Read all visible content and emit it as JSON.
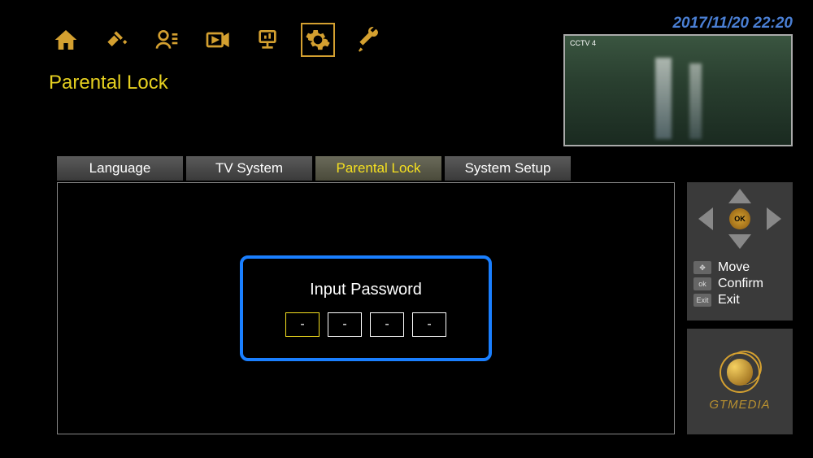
{
  "datetime": "2017/11/20  22:20",
  "page_title": "Parental Lock",
  "nav_icons": [
    "home",
    "satellite",
    "user",
    "media",
    "network",
    "settings",
    "tools"
  ],
  "nav_selected_index": 5,
  "preview_channel": "CCTV 4",
  "tabs": [
    {
      "label": "Language",
      "active": false
    },
    {
      "label": "TV System",
      "active": false
    },
    {
      "label": "Parental Lock",
      "active": true
    },
    {
      "label": "System Setup",
      "active": false
    }
  ],
  "password_dialog": {
    "title": "Input Password",
    "boxes": [
      "-",
      "-",
      "-",
      "-"
    ],
    "active_index": 0
  },
  "dpad": {
    "ok": "OK"
  },
  "legend": [
    {
      "key": "✥",
      "label": "Move"
    },
    {
      "key": "ok",
      "label": "Confirm"
    },
    {
      "key": "Exit",
      "label": "Exit"
    }
  ],
  "brand": "GTMEDIA"
}
